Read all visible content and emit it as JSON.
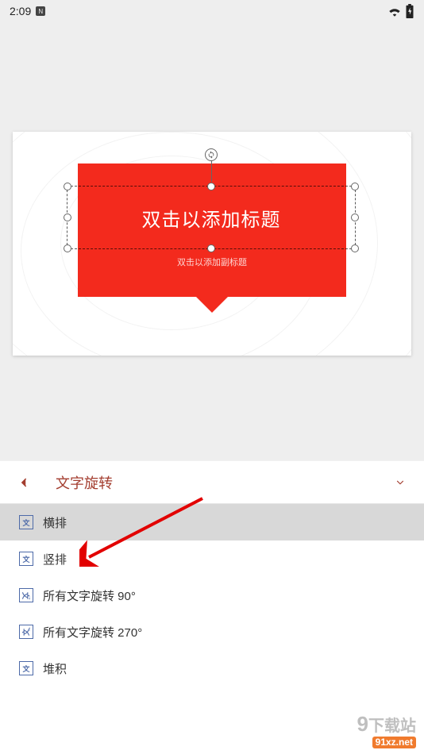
{
  "status": {
    "time": "2:09",
    "badge": "N"
  },
  "slide": {
    "title_placeholder": "双击以添加标题",
    "subtitle_placeholder": "双击以添加副标题"
  },
  "panel": {
    "title": "文字旋转",
    "options": [
      {
        "label": "横排",
        "icon": "text-horizontal-icon"
      },
      {
        "label": "竖排",
        "icon": "text-vertical-icon"
      },
      {
        "label": "所有文字旋转 90°",
        "icon": "text-rotate-90-icon"
      },
      {
        "label": "所有文字旋转 270°",
        "icon": "text-rotate-270-icon"
      },
      {
        "label": "堆积",
        "icon": "text-stacked-icon"
      }
    ],
    "selected_index": 0
  },
  "watermark": {
    "line1a": "9",
    "line1b": "下载站",
    "line2": "91xz.net"
  }
}
